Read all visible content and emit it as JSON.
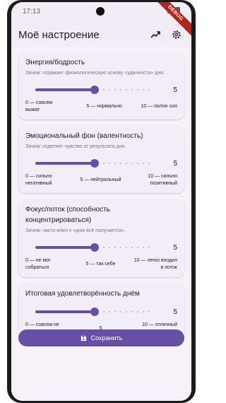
{
  "status_bar": {
    "time": "17:13"
  },
  "debug_banner": "DEBUG",
  "app_bar": {
    "title": "Моё настроение",
    "trend_icon": "trending-up-icon",
    "settings_icon": "gear-icon"
  },
  "colors": {
    "accent": "#6750a4",
    "surface": "#f7f2fa",
    "card": "#f3edf7"
  },
  "cards": [
    {
      "title": "Энергия/бодрость",
      "hint": "Зачем: отражает физиологическую основу «удачности» дня.",
      "value": 5,
      "max": 10,
      "low": "0 — совсем выжат",
      "mid": "5 — нормально",
      "high": "10 — полон сил"
    },
    {
      "title": "Эмоциональный фон (валентность)",
      "hint": "Зачем: отделяет чувство от результата дня.",
      "value": 5,
      "max": 10,
      "low": "0 — сильно негативный",
      "mid": "5 — нейтральный",
      "high": "10 — сильно позитивный"
    },
    {
      "title": "Фокус/поток (способность концентрироваться)",
      "hint": "Зачем: часто ключ к «дню всё получается».",
      "value": 5,
      "max": 10,
      "low": "0 — не мог собраться",
      "mid": "5 — так себе",
      "high": "10 — легко входил в поток"
    },
    {
      "title": "Итоговая удовлетворённость днём",
      "hint": "",
      "value": 5,
      "max": 10,
      "low": "0 — совсем не доволен",
      "mid": "5",
      "high": "10 — отличный день"
    }
  ],
  "save_button": {
    "label": "Сохранить",
    "icon": "save-icon"
  }
}
